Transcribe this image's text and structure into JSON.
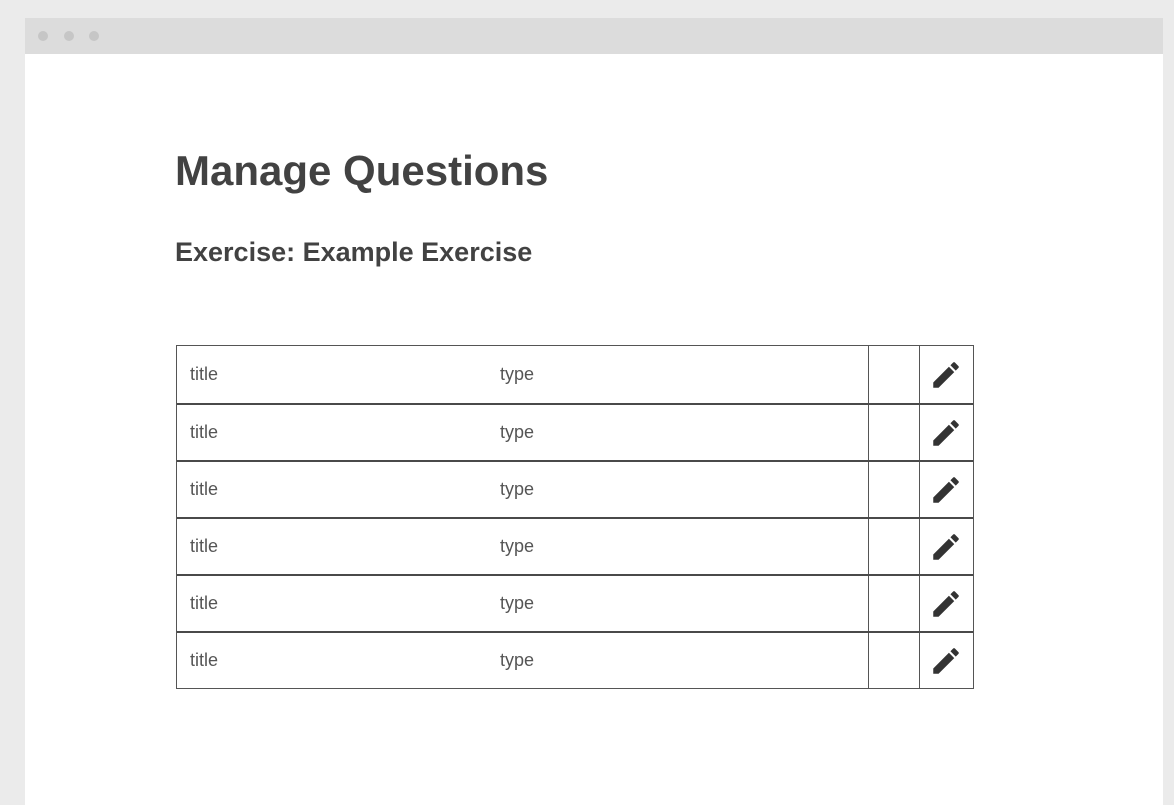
{
  "page": {
    "title": "Manage Questions",
    "subtitle": "Exercise: Example Exercise"
  },
  "table": {
    "rows": [
      {
        "title": "title",
        "type": "type",
        "action_icon": "pencil-icon"
      },
      {
        "title": "title",
        "type": "type",
        "action_icon": "pencil-icon"
      },
      {
        "title": "title",
        "type": "type",
        "action_icon": "pencil-icon"
      },
      {
        "title": "title",
        "type": "type",
        "action_icon": "pencil-icon"
      },
      {
        "title": "title",
        "type": "type",
        "action_icon": "pencil-icon"
      },
      {
        "title": "title",
        "type": "type",
        "action_icon": "pencil-icon"
      }
    ]
  },
  "colors": {
    "text": "#424242",
    "border": "#4a4a4a",
    "window_frame": "#ebebeb",
    "titlebar": "#dcdcdc"
  }
}
